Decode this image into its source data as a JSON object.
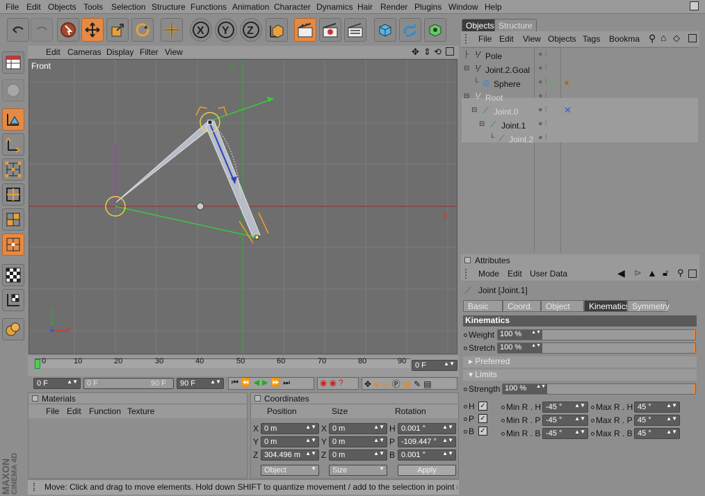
{
  "menu": [
    "File",
    "Edit",
    "Objects",
    "Tools",
    "Selection",
    "Structure",
    "Functions",
    "Animation",
    "Character",
    "Dynamics",
    "Hair",
    "Render",
    "Plugins",
    "Window",
    "Help"
  ],
  "viewport": {
    "menu": [
      "Edit",
      "Cameras",
      "Display",
      "Filter",
      "View"
    ],
    "label": "Front",
    "axis_y": "Y",
    "axis_x": "X",
    "gizmo_y": "Y",
    "gizmo_z": "Z",
    "gizmo_x": "X"
  },
  "timeline": {
    "ticks": [
      "0",
      "10",
      "20",
      "30",
      "40",
      "50",
      "60",
      "70",
      "80",
      "90"
    ],
    "current": "0 F",
    "start": "0 F",
    "range_start": "0 F",
    "range_end": "90 F",
    "end": "90 F"
  },
  "materials": {
    "title": "Materials",
    "menu": [
      "File",
      "Edit",
      "Function",
      "Texture"
    ]
  },
  "coordinates": {
    "title": "Coordinates",
    "headers": [
      "Position",
      "Size",
      "Rotation"
    ],
    "rows": [
      {
        "a": "X",
        "pos": "0 m",
        "b": "X",
        "size": "0 m",
        "c": "H",
        "rot": "0.001 °"
      },
      {
        "a": "Y",
        "pos": "0 m",
        "b": "Y",
        "size": "0 m",
        "c": "P",
        "rot": "-109.447 °"
      },
      {
        "a": "Z",
        "pos": "304.496 m",
        "b": "Z",
        "size": "0 m",
        "c": "B",
        "rot": "0.001 °"
      }
    ],
    "mode": "Object",
    "size_mode": "Size",
    "apply": "Apply"
  },
  "status": "Move: Click and drag to move elements. Hold down SHIFT to quantize movement / add to the selection in point mode, CTRL t",
  "logo": {
    "line1": "MAXON",
    "line2": "CINEMA 4D"
  },
  "object_manager": {
    "tabs": [
      "Objects",
      "Structure"
    ],
    "menu": [
      "File",
      "Edit",
      "View",
      "Objects",
      "Tags",
      "Bookma"
    ],
    "objects": [
      {
        "name": "Pole",
        "dim": false
      },
      {
        "name": "Joint.2.Goal",
        "dim": false
      },
      {
        "name": "Sphere",
        "dim": false
      },
      {
        "name": "Root",
        "dim": true
      },
      {
        "name": "Joint.0",
        "dim": true
      },
      {
        "name": "Joint.1",
        "dim": false
      },
      {
        "name": "Joint.2",
        "dim": true
      }
    ]
  },
  "attributes": {
    "title": "Attributes",
    "menu": [
      "Mode",
      "Edit",
      "User Data"
    ],
    "object": "Joint [Joint.1]",
    "tabs": [
      "Basic",
      "Coord.",
      "Object",
      "Kinematics",
      "Symmetry"
    ],
    "active_tab": "Kinematics",
    "section": "Kinematics",
    "weight_label": "Weight",
    "weight": "100 %",
    "weight_fraction": 1.0,
    "stretch_label": "Stretch",
    "stretch": "100 %",
    "stretch_fraction": 1.0,
    "preferred": "Preferred",
    "limits": "Limits",
    "strength_label": "Strength",
    "strength": "100 %",
    "strength_fraction": 1.0,
    "limit_rows": [
      {
        "axis": "H",
        "min_label": "Min R . H",
        "min": "-45 °",
        "max_label": "Max R . H",
        "max": "45 °"
      },
      {
        "axis": "P",
        "min_label": "Min R . P",
        "min": "-45 °",
        "max_label": "Max R . P",
        "max": "45 °"
      },
      {
        "axis": "B",
        "min_label": "Min R . B",
        "min": "-45 °",
        "max_label": "Max R . B",
        "max": "45 °"
      }
    ]
  },
  "colors": {
    "accent": "#e58a44",
    "selected_tab": "#3c3c3c"
  }
}
